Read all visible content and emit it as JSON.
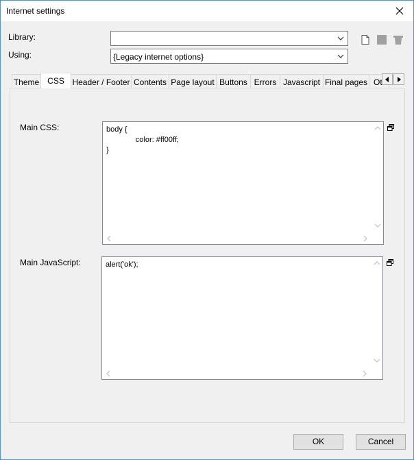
{
  "window": {
    "title": "Internet settings"
  },
  "form": {
    "library_label": "Library:",
    "library_value": "",
    "using_label": "Using:",
    "using_value": "{Legacy internet options}"
  },
  "tabs": [
    {
      "label": "Theme"
    },
    {
      "label": "CSS"
    },
    {
      "label": "Header / Footer"
    },
    {
      "label": "Contents"
    },
    {
      "label": "Page layout"
    },
    {
      "label": "Buttons"
    },
    {
      "label": "Errors"
    },
    {
      "label": "Javascript"
    },
    {
      "label": "Final pages"
    },
    {
      "label": "Ot"
    }
  ],
  "active_tab": "CSS",
  "css_editor": {
    "label": "Main CSS:",
    "content": "body {\n              color: #ff00ff;\n}"
  },
  "js_editor": {
    "label": "Main JavaScript:",
    "content": "alert('ok');"
  },
  "buttons": {
    "ok": "OK",
    "cancel": "Cancel"
  },
  "colors": {
    "window_border": "#5a8fd0",
    "background": "#f0f0f0"
  },
  "icons": [
    "close-icon",
    "chevron-down-icon",
    "new-document-icon",
    "save-icon",
    "delete-icon",
    "popout-icon",
    "scroll-left-icon",
    "scroll-right-icon"
  ]
}
